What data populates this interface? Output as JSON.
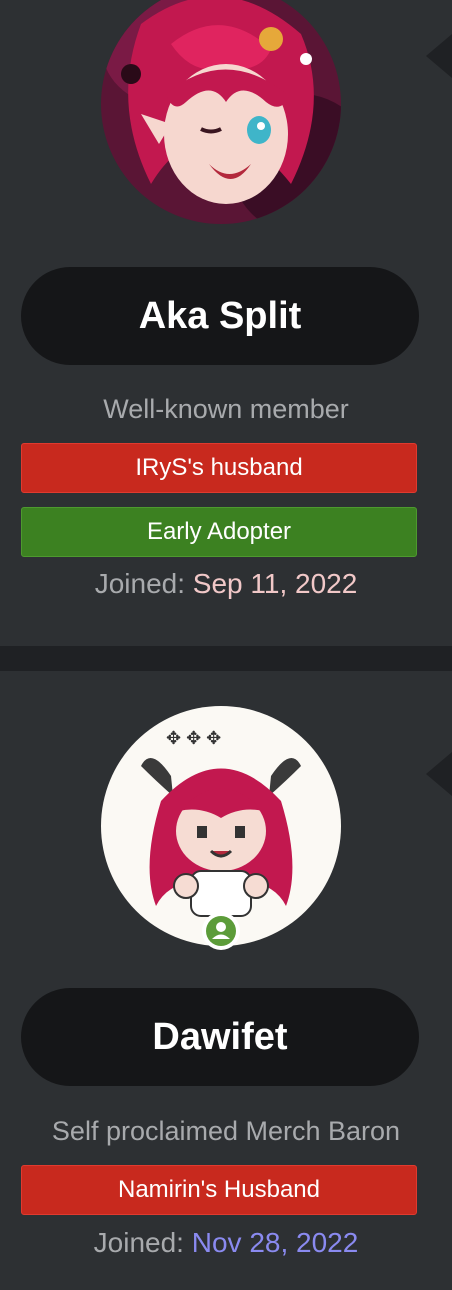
{
  "members": [
    {
      "username": "Aka Split",
      "user_title": "Well-known member",
      "banners": [
        "IRyS's husband",
        "Early Adopter"
      ],
      "joined_label": "Joined:",
      "joined_date": "Sep 11, 2022",
      "avatar_icon": "anime-avatar-icon"
    },
    {
      "username": "Dawifet",
      "user_title": "Self proclaimed Merch Baron",
      "banners": [
        "Namirin's Husband"
      ],
      "joined_label": "Joined:",
      "joined_date": "Nov 28, 2022",
      "avatar_icon": "chibi-avatar-icon",
      "online_icon": "online-status-icon"
    }
  ],
  "colors": {
    "background": "#2d3033",
    "pill": "#151618",
    "banner_red": "#c8291e",
    "banner_green": "#3c8121",
    "date_pink": "#f1c8c8",
    "date_blue": "#8a8af0",
    "online_green": "#5c9c3a"
  }
}
